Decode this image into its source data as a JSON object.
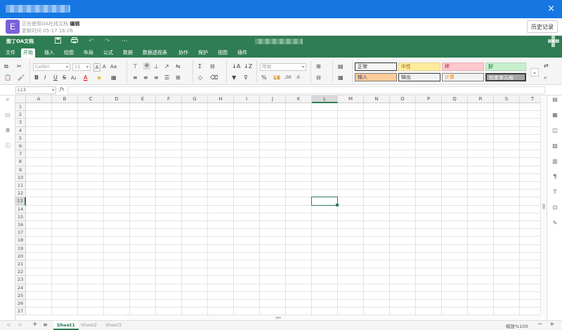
{
  "window": {
    "close_label": "×"
  },
  "doc": {
    "badge": "E",
    "status_prefix": "正在使用OA在线文档",
    "status_mode": "编辑",
    "updated": "更新时间 05-17 16:26",
    "history_button": "历史记录"
  },
  "app": {
    "brand": "图丁OA文档",
    "quick_icons": [
      "save-icon",
      "print-icon",
      "undo-icon",
      "redo-icon",
      "more-icon"
    ]
  },
  "menu": {
    "items": [
      "文件",
      "开始",
      "插入",
      "绘图",
      "布局",
      "公式",
      "数据",
      "数据透视表",
      "协作",
      "保护",
      "视图",
      "插件"
    ],
    "active": "开始"
  },
  "ribbon": {
    "font_family": "Calibri",
    "font_size": "11",
    "number_format": "常规",
    "styles": [
      {
        "label": "正常",
        "bg": "#ffffff",
        "fg": "#000000"
      },
      {
        "label": "中性",
        "bg": "#ffeb9c",
        "fg": "#9c6500"
      },
      {
        "label": "坏",
        "bg": "#ffc7ce",
        "fg": "#9c0006"
      },
      {
        "label": "好",
        "bg": "#c6efce",
        "fg": "#006100"
      },
      {
        "label": "输入",
        "bg": "#ffcc99",
        "fg": "#3f3f76"
      },
      {
        "label": "输出",
        "bg": "#f2f2f2",
        "fg": "#3f3f3f"
      },
      {
        "label": "计算",
        "bg": "#f2f2f2",
        "fg": "#fa7d00"
      },
      {
        "label": "检查单元格",
        "bg": "#a5a5a5",
        "fg": "#ffffff"
      }
    ]
  },
  "formula": {
    "name_box": "L13",
    "fx": "fx",
    "value": ""
  },
  "grid": {
    "columns": [
      "A",
      "B",
      "C",
      "D",
      "E",
      "F",
      "G",
      "H",
      "I",
      "J",
      "K",
      "L",
      "M",
      "N",
      "O",
      "P",
      "Q",
      "R",
      "S",
      "T"
    ],
    "rows": [
      "1",
      "2",
      "3",
      "4",
      "5",
      "6",
      "7",
      "8",
      "9",
      "10",
      "11",
      "12",
      "13",
      "14",
      "15",
      "16",
      "17",
      "18",
      "19",
      "20",
      "21",
      "22",
      "23",
      "24",
      "25",
      "26",
      "27"
    ],
    "active_col": "L",
    "active_row": "13"
  },
  "sheets": {
    "tabs": [
      "Sheet1",
      "Sheet2",
      "Sheet3"
    ],
    "active": "Sheet1",
    "add": "+",
    "list": "≡",
    "prev": "<",
    "next": ">"
  },
  "zoom": {
    "label": "缩放%100",
    "minus": "−",
    "plus": "+"
  },
  "colors": {
    "titlebar": "#1677e3",
    "brand_green": "#2f7d52",
    "badge": "#7b61d9"
  }
}
